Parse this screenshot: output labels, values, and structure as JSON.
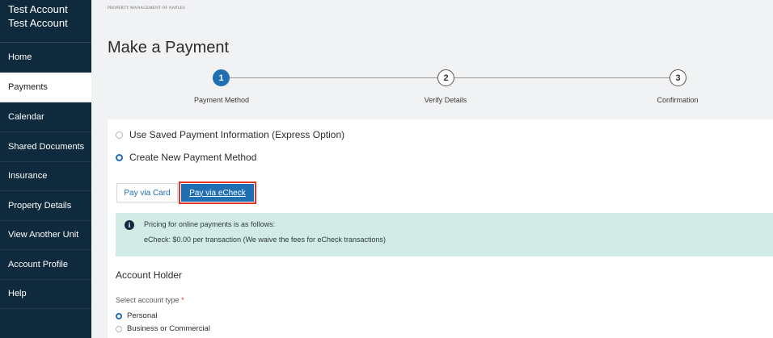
{
  "sidebar": {
    "account_line1": "Test Account",
    "account_line2": "Test Account",
    "items": [
      {
        "label": "Home",
        "active": false
      },
      {
        "label": "Payments",
        "active": true
      },
      {
        "label": "Calendar",
        "active": false
      },
      {
        "label": "Shared Documents",
        "active": false
      },
      {
        "label": "Insurance",
        "active": false
      },
      {
        "label": "Property Details",
        "active": false
      },
      {
        "label": "View Another Unit",
        "active": false
      },
      {
        "label": "Account Profile",
        "active": false
      },
      {
        "label": "Help",
        "active": false
      }
    ]
  },
  "header": {
    "brand": "PROPERTY MANAGEMENT OF NAPLES",
    "page_title": "Make a Payment"
  },
  "stepper": {
    "steps": [
      {
        "number": "1",
        "label": "Payment Method",
        "state": "current"
      },
      {
        "number": "2",
        "label": "Verify Details",
        "state": "upcoming"
      },
      {
        "number": "3",
        "label": "Confirmation",
        "state": "upcoming"
      }
    ]
  },
  "payment_options": {
    "saved": "Use Saved Payment Information (Express Option)",
    "new": "Create New Payment Method",
    "selected": "new"
  },
  "tabs": {
    "card": "Pay via Card",
    "echeck": "Pay via eCheck",
    "selected": "echeck"
  },
  "info": {
    "line1": "Pricing for online payments is as follows:",
    "line2": "eCheck: $0.00 per transaction (We waive the fees for eCheck transactions)",
    "icon": "info-icon"
  },
  "account_holder": {
    "title": "Account Holder",
    "type_label": "Select account type",
    "required_mark": "*",
    "options": [
      "Personal",
      "Business or Commercial"
    ],
    "selected": "Personal"
  },
  "colors": {
    "sidebar_bg": "#0f2a3d",
    "accent": "#1f6fb2",
    "highlight_outline": "#e0352b",
    "info_bg": "#d2ebe6"
  }
}
